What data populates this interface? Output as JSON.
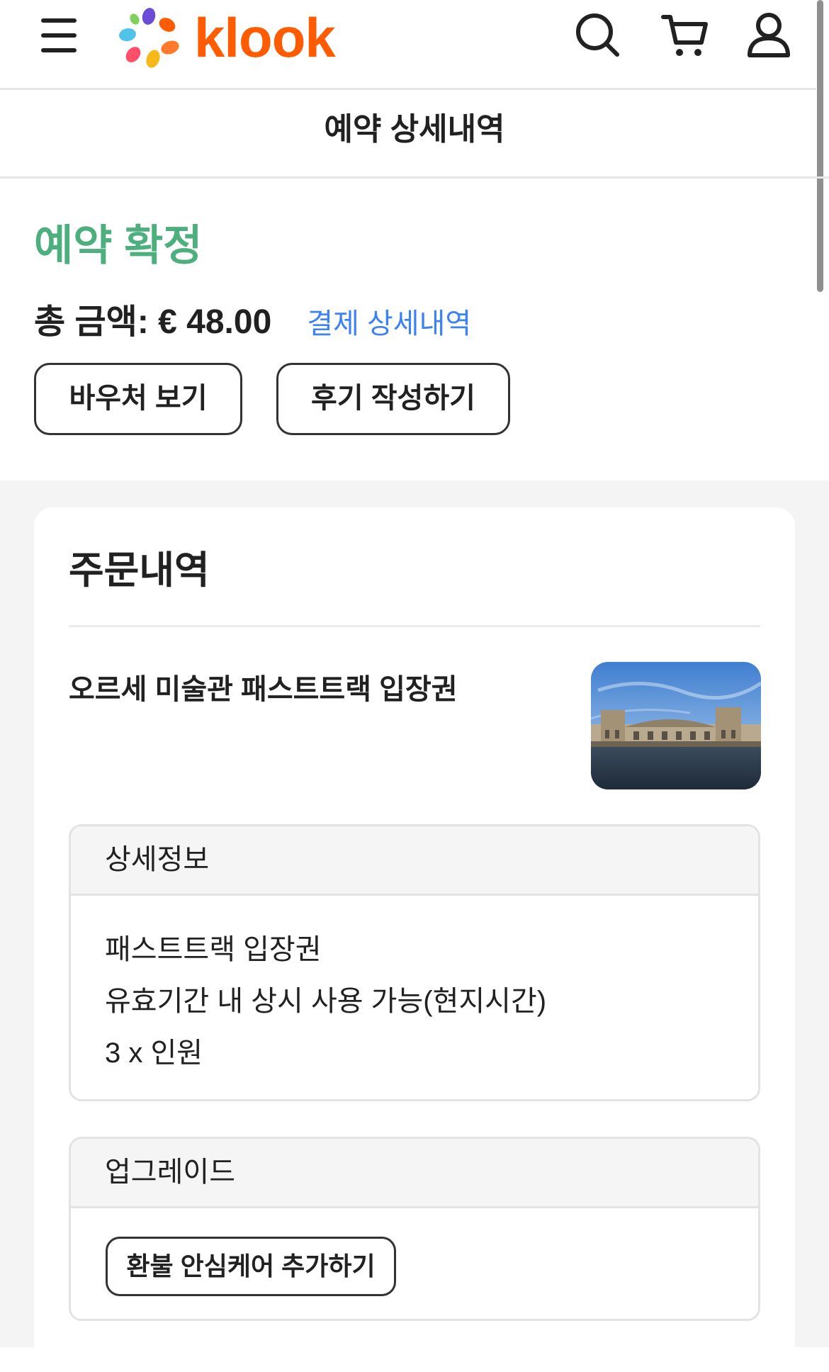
{
  "brand": {
    "name": "klook",
    "logo_colors": [
      "#4fc3e8",
      "#6b4bd8",
      "#ff5b00",
      "#f6b919",
      "#ff4f6a",
      "#7fd15b"
    ]
  },
  "header": {
    "icons": [
      "hamburger-menu-icon",
      "search-icon",
      "cart-icon",
      "user-icon"
    ]
  },
  "page": {
    "title": "예약 상세내역"
  },
  "booking": {
    "status": "예약 확정",
    "status_color": "#4caf7d",
    "total": "총 금액: € 48.00",
    "payment_details_link": "결제 상세내역",
    "link_color": "#3b82f6",
    "view_voucher_button": "바우처 보기",
    "write_review_button": "후기 작성하기"
  },
  "order": {
    "title": "주문내역",
    "product_name": "오르세 미술관 패스트트랙 입장권",
    "details": {
      "header": "상세정보",
      "lines": [
        "패스트트랙 입장권",
        "유효기간 내 상시 사용 가능(현지시간)",
        "3 x 인원"
      ]
    },
    "upgrade": {
      "header": "업그레이드",
      "button": "환불 안심케어 추가하기"
    }
  }
}
